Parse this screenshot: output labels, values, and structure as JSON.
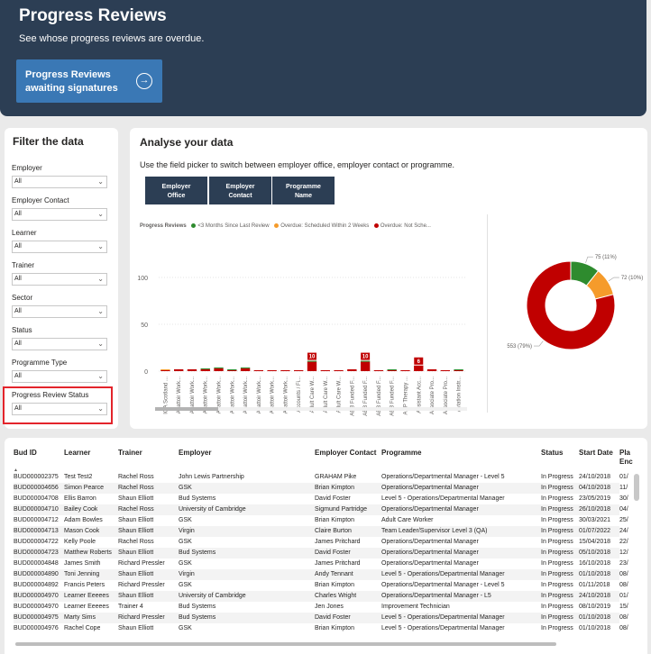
{
  "header": {
    "title": "Progress Reviews",
    "subtitle": "See whose progress reviews are overdue.",
    "button_line1": "Progress Reviews",
    "button_line2": "awaiting signatures"
  },
  "filters": {
    "title": "Filter the data",
    "items": [
      {
        "label": "Employer",
        "value": "All"
      },
      {
        "label": "Employer Contact",
        "value": "All"
      },
      {
        "label": "Learner",
        "value": "All"
      },
      {
        "label": "Trainer",
        "value": "All"
      },
      {
        "label": "Sector",
        "value": "All"
      },
      {
        "label": "Status",
        "value": "All"
      },
      {
        "label": "Programme Type",
        "value": "All"
      },
      {
        "label": "Progress Review Status",
        "value": "All"
      }
    ]
  },
  "analyse": {
    "title": "Analyse your data",
    "description": "Use the field picker to switch between employer office, employer contact or programme.",
    "pickers": [
      {
        "line1": "Employer",
        "line2": "Office"
      },
      {
        "line1": "Employer",
        "line2": "Contact"
      },
      {
        "line1": "Programme",
        "line2": "Name"
      }
    ],
    "legend_title": "Progress Reviews",
    "legend": [
      {
        "label": "<3 Months Since Last Review",
        "color": "#2e8b2e"
      },
      {
        "label": "Overdue: Scheduled Within 2 Weeks",
        "color": "#f59b2b"
      },
      {
        "label": "Overdue: Not Sche...",
        "color": "#c00000"
      }
    ]
  },
  "chart_data": [
    {
      "type": "bar",
      "ylim": [
        0,
        100
      ],
      "yticks": [
        "100",
        "50",
        "0"
      ],
      "categories": [
        "IQA Scotland ...",
        "Abattoir Work...",
        "Abattoir Work...",
        "Abattoir Work...",
        "Abattoir Work...",
        "Abattoir Work...",
        "Abattoir Work...",
        "Abattoir Work...",
        "Abattoir Work...",
        "Abattoir Work...",
        "Accounts / Fi...",
        "Adult Care W...",
        "Adult Care W...",
        "Adult Care W...",
        "AEB Funded F...",
        "AEB Funded F...",
        "AEB Funded F...",
        "AEB Funded F...",
        "AHP Therapy ...",
        "Assistant Acc...",
        "Associate Pro...",
        "Associate Pro...",
        "Aviation Instr..."
      ],
      "series": [
        {
          "name": "<3 Months Since Last Review",
          "color": "#2e8b2e",
          "values": [
            0,
            0,
            0,
            1,
            1,
            1,
            1,
            0,
            0,
            0,
            0,
            1,
            0,
            0,
            0,
            1,
            0,
            1,
            0,
            0,
            0,
            0,
            1
          ]
        },
        {
          "name": "Overdue: Scheduled Within 2 Weeks",
          "color": "#f59b2b",
          "values": [
            1,
            0,
            0,
            0,
            0,
            0,
            0,
            0,
            0,
            0,
            0,
            0,
            0,
            0,
            0,
            0,
            0,
            0,
            0,
            0,
            0,
            0,
            0
          ]
        },
        {
          "name": "Overdue: Not Sche...",
          "color": "#c00000",
          "values": [
            1,
            2,
            2,
            2,
            3,
            1,
            3,
            1,
            1,
            1,
            1,
            10,
            1,
            1,
            2,
            10,
            1,
            1,
            1,
            6,
            2,
            1,
            1
          ]
        }
      ],
      "data_labels": {
        "11": "10",
        "15": "10",
        "19": "6"
      }
    },
    {
      "type": "pie",
      "labels": [
        "<3 Months Since Last Review",
        "Overdue: Scheduled Within 2 Weeks",
        "Overdue: Not Sche..."
      ],
      "values": [
        75,
        72,
        553
      ],
      "display_labels": [
        "75 (11%)",
        "72 (10%)",
        "553 (79%)"
      ],
      "colors": [
        "#2e8b2e",
        "#f59b2b",
        "#c00000"
      ]
    }
  ],
  "table": {
    "columns": [
      "Bud ID",
      "Learner",
      "Trainer",
      "Employer",
      "Employer Contact",
      "Programme",
      "Status",
      "Start Date",
      "Pla Enc"
    ],
    "rows": [
      [
        "BUD000002375",
        "Test Test2",
        "Rachel Ross",
        "John Lewis Partnership",
        "GRAHAM Pike",
        "Operations/Departmental Manager - Level 5",
        "In Progress",
        "24/10/2018",
        "01/"
      ],
      [
        "BUD000004656",
        "Simon Pearce",
        "Rachel Ross",
        "GSK",
        "Brian Kimpton",
        "Operations/Departmental Manager",
        "In Progress",
        "04/10/2018",
        "11/"
      ],
      [
        "BUD000004708",
        "Ellis Barron",
        "Shaun Elliott",
        "Bud Systems",
        "David Foster",
        "Level 5 - Operations/Departmental Manager",
        "In Progress",
        "23/05/2019",
        "30/"
      ],
      [
        "BUD000004710",
        "Bailey Cook",
        "Rachel Ross",
        "University of Cambridge",
        "Sigmund Partridge",
        "Operations/Departmental Manager",
        "In Progress",
        "26/10/2018",
        "04/"
      ],
      [
        "BUD000004712",
        "Adam Bowles",
        "Shaun Elliott",
        "GSK",
        "Brian Kimpton",
        "Adult Care Worker",
        "In Progress",
        "30/03/2021",
        "25/"
      ],
      [
        "BUD000004713",
        "Mason Cook",
        "Shaun Elliott",
        "Virgin",
        "Claire Burton",
        "Team Leader/Supervisor Level 3 (QA)",
        "In Progress",
        "01/07/2022",
        "24/"
      ],
      [
        "BUD000004722",
        "Kelly Poole",
        "Rachel Ross",
        "GSK",
        "James Pritchard",
        "Operations/Departmental Manager",
        "In Progress",
        "15/04/2018",
        "22/"
      ],
      [
        "BUD000004723",
        "Matthew Roberts",
        "Shaun Elliott",
        "Bud Systems",
        "David Foster",
        "Operations/Departmental Manager",
        "In Progress",
        "05/10/2018",
        "12/"
      ],
      [
        "BUD000004848",
        "James Smith",
        "Richard Pressler",
        "GSK",
        "James Pritchard",
        "Operations/Departmental Manager",
        "In Progress",
        "16/10/2018",
        "23/"
      ],
      [
        "BUD000004890",
        "Toni Jenning",
        "Shaun Elliott",
        "Virgin",
        "Andy Tennant",
        "Level 5 - Operations/Departmental Manager",
        "In Progress",
        "01/10/2018",
        "08/"
      ],
      [
        "BUD000004892",
        "Francis Peters",
        "Richard Pressler",
        "GSK",
        "Brian Kimpton",
        "Operations/Departmental Manager - Level 5",
        "In Progress",
        "01/11/2018",
        "08/"
      ],
      [
        "BUD000004970",
        "Learner Eeeees",
        "Shaun Elliott",
        "University of Cambridge",
        "Charles Wright",
        "Operations/Departmental Manager - L5",
        "In Progress",
        "24/10/2018",
        "01/"
      ],
      [
        "BUD000004970",
        "Learner Eeeees",
        "Trainer 4",
        "Bud Systems",
        "Jen Jones",
        "Improvement Technician",
        "In Progress",
        "08/10/2019",
        "15/"
      ],
      [
        "BUD000004975",
        "Marty Sims",
        "Richard Pressler",
        "Bud Systems",
        "David Foster",
        "Level 5 - Operations/Departmental Manager",
        "In Progress",
        "01/10/2018",
        "08/"
      ],
      [
        "BUD000004976",
        "Rachel Cope",
        "Shaun Elliott",
        "GSK",
        "Brian Kimpton",
        "Level 5 - Operations/Departmental Manager",
        "In Progress",
        "01/10/2018",
        "08/"
      ]
    ]
  }
}
